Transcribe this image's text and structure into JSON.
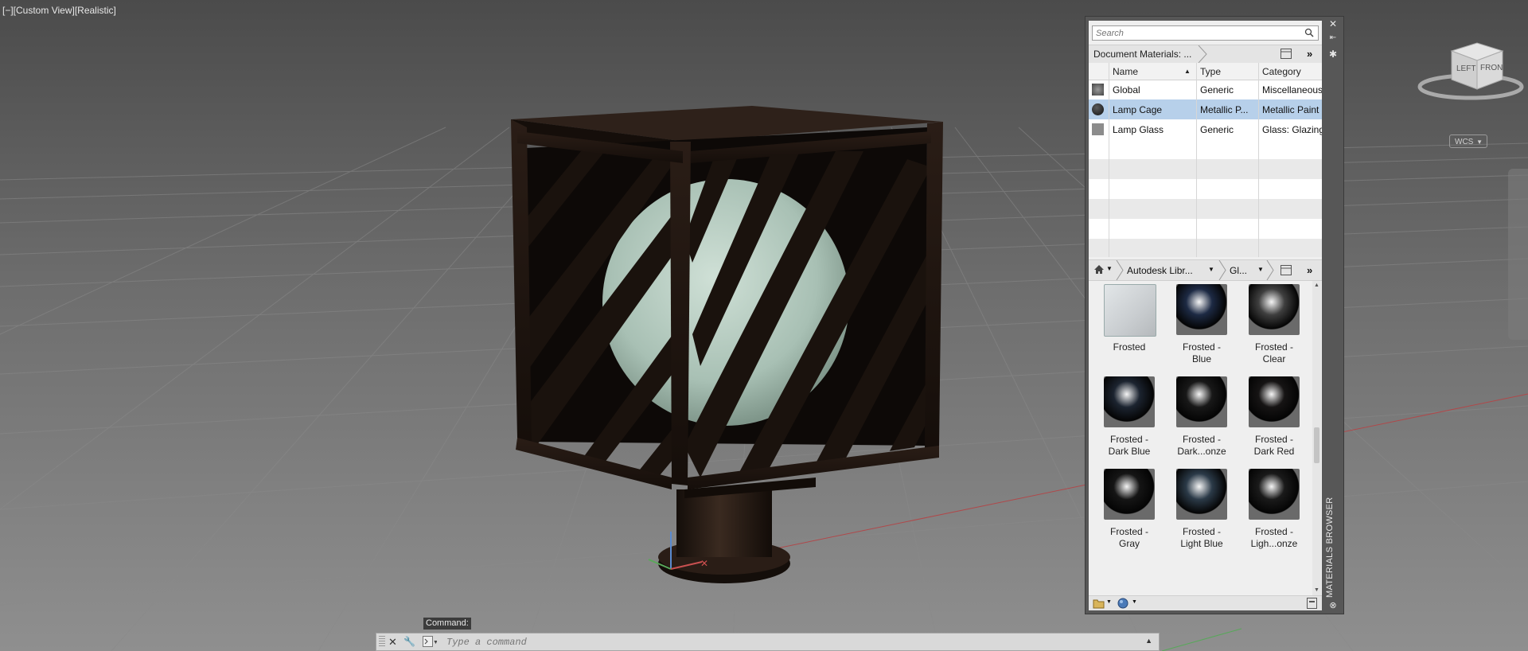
{
  "viewport": {
    "label": "[−][Custom View][Realistic]",
    "wcs": "WCS",
    "viewcube_left": "LEFT",
    "viewcube_front": "FRONT"
  },
  "materials_browser": {
    "title": "MATERIALS BROWSER",
    "search_placeholder": "Search",
    "doc_breadcrumb": "Document Materials: ...",
    "columns": {
      "name": "Name",
      "type": "Type",
      "category": "Category"
    },
    "rows": [
      {
        "name": "Global",
        "type": "Generic",
        "category": "Miscellaneous",
        "swatch": "#6f6f6f"
      },
      {
        "name": "Lamp Cage",
        "type": "Metallic P...",
        "category": "Metallic Paint",
        "swatch": "#1e1e1e"
      },
      {
        "name": "Lamp Glass",
        "type": "Generic",
        "category": "Glass: Glazing",
        "swatch": "#8c8c8c"
      }
    ],
    "selected_row": "Lamp Cage",
    "library_breadcrumb": "Autodesk Libr...",
    "category_breadcrumb": "Gl...",
    "library_items": [
      {
        "line1": "Frosted",
        "line2": "",
        "color": "#c9cdd0",
        "style": "flat"
      },
      {
        "line1": "Frosted -",
        "line2": "Blue",
        "color": "#1d2a44",
        "style": "sphere"
      },
      {
        "line1": "Frosted -",
        "line2": "Clear",
        "color": "#3f3f3f",
        "style": "sphere"
      },
      {
        "line1": "Frosted -",
        "line2": "Dark Blue",
        "color": "#1c2430",
        "style": "sphere"
      },
      {
        "line1": "Frosted -",
        "line2": "Dark...onze",
        "color": "#181818",
        "style": "sphere"
      },
      {
        "line1": "Frosted -",
        "line2": "Dark Red",
        "color": "#161414",
        "style": "sphere"
      },
      {
        "line1": "Frosted -",
        "line2": "Gray",
        "color": "#151515",
        "style": "sphere"
      },
      {
        "line1": "Frosted -",
        "line2": "Light Blue",
        "color": "#2b3a48",
        "style": "sphere"
      },
      {
        "line1": "Frosted -",
        "line2": "Ligh...onze",
        "color": "#1a1a1a",
        "style": "sphere"
      }
    ]
  },
  "command_line": {
    "label": "Command:",
    "placeholder": "Type a command"
  },
  "colors": {
    "selection": "#b7d0ea",
    "palette_frame": "#575757",
    "cage": "#1c1410",
    "globe": "#a8c0b4"
  }
}
